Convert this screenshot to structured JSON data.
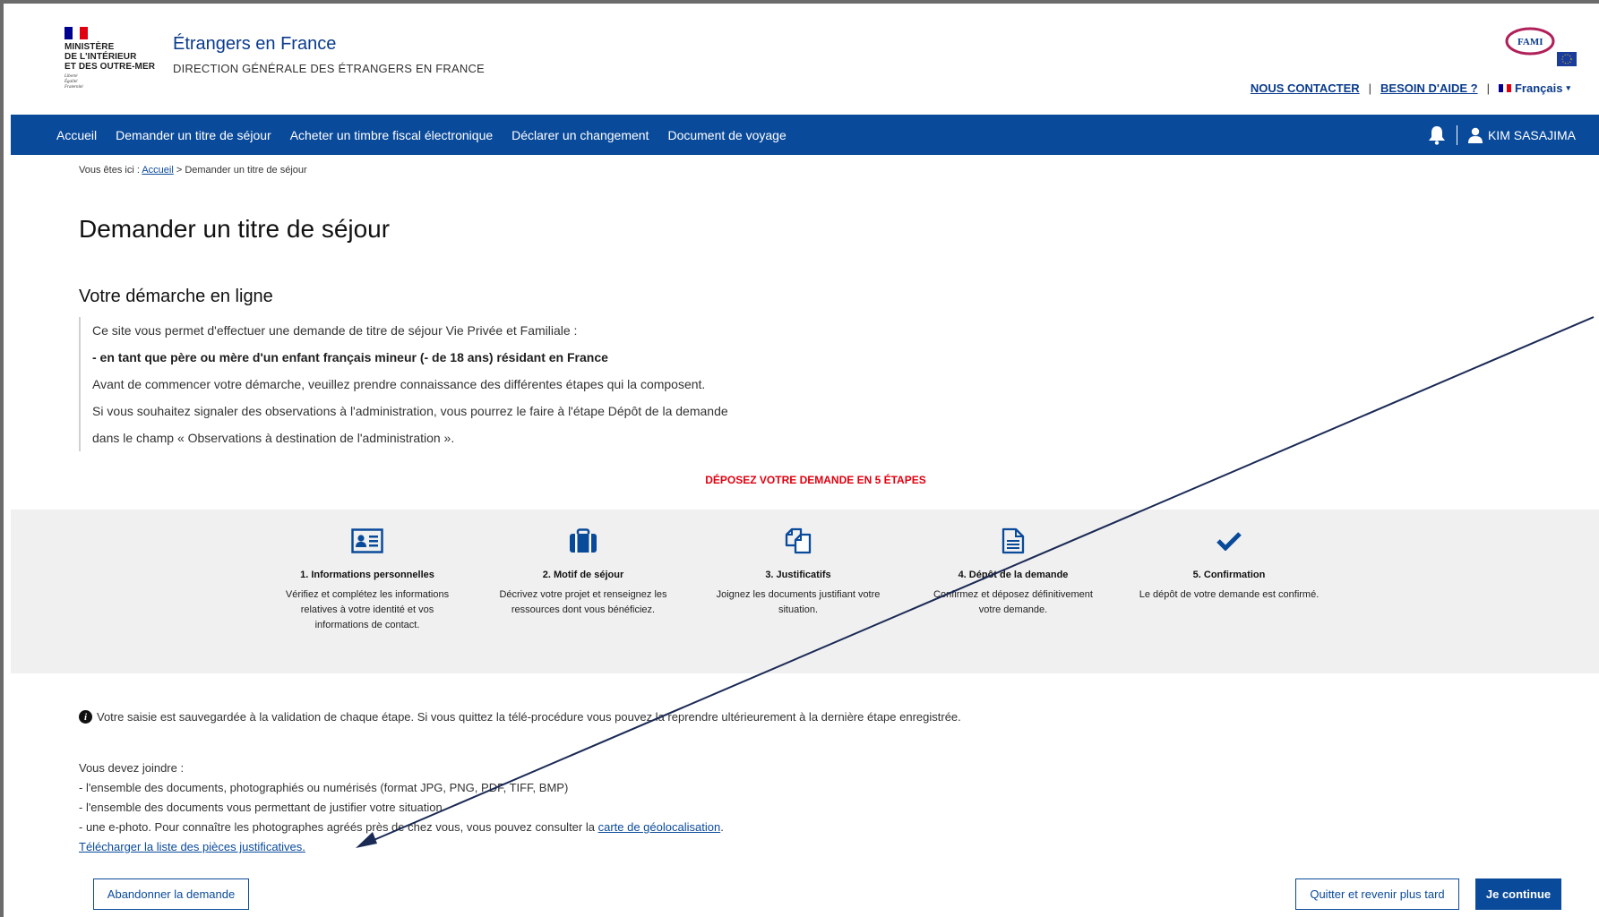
{
  "header": {
    "ministry_lines": [
      "MINISTÈRE",
      "DE L'INTÉRIEUR",
      "ET DES OUTRE-MER"
    ],
    "motto_lines": [
      "Liberté",
      "Égalité",
      "Fraternité"
    ],
    "site_title": "Étrangers en France",
    "site_subtitle": "DIRECTION GÉNÉRALE DES ÉTRANGERS EN FRANCE",
    "fami_label": "FAMI",
    "contact_link": "NOUS CONTACTER",
    "help_link": "BESOIN D'AIDE ?",
    "language": "Français"
  },
  "nav": {
    "items": [
      "Accueil",
      "Demander un titre de séjour",
      "Acheter un timbre fiscal électronique",
      "Déclarer un changement",
      "Document de voyage"
    ],
    "user_name": "KIM SASAJIMA"
  },
  "breadcrumb": {
    "prefix": "Vous êtes ici : ",
    "home": "Accueil",
    "current": " > Demander un titre de séjour"
  },
  "page_title": "Demander un titre de séjour",
  "section_title": "Votre démarche en ligne",
  "intro": [
    "Ce site vous permet d'effectuer une demande de titre de séjour Vie Privée et Familiale :",
    "- en tant que père ou mère d'un enfant français mineur (- de 18 ans) résidant en France",
    "Avant de commencer votre démarche, veuillez prendre connaissance des différentes étapes qui la composent.",
    "Si vous souhaitez signaler des observations à l'administration, vous pourrez le faire à l'étape Dépôt de la demande",
    "dans le champ « Observations à destination de l'administration »."
  ],
  "steps_heading": "DÉPOSEZ VOTRE DEMANDE EN 5 ÉTAPES",
  "steps": [
    {
      "icon": "id-card-icon",
      "title": "1. Informations personnelles",
      "desc": "Vérifiez et complétez les informations relatives à votre identité et vos informations de contact."
    },
    {
      "icon": "briefcase-icon",
      "title": "2. Motif de séjour",
      "desc": "Décrivez votre projet et renseignez les ressources dont vous bénéficiez."
    },
    {
      "icon": "copy-documents-icon",
      "title": "3. Justificatifs",
      "desc": "Joignez les documents justifiant votre situation."
    },
    {
      "icon": "document-icon",
      "title": "4. Dépôt de la demande",
      "desc": "Confirmez et déposez définitivement votre demande."
    },
    {
      "icon": "checkmark-icon",
      "title": "5. Confirmation",
      "desc": "Le dépôt de votre demande est confirmé."
    }
  ],
  "info_message": "Votre saisie est sauvegardée à la validation de chaque étape. Si vous quittez la télé-procédure vous pouvez la reprendre ultérieurement à la dernière étape enregistrée.",
  "docs": {
    "heading": "Vous devez joindre :",
    "line1": "- l'ensemble des documents, photographiés ou numérisés (format JPG, PNG, PDF, TIFF, BMP)",
    "line2": "- l'ensemble des documents vous permettant de justifier votre situation",
    "line3_prefix": "- une e-photo. Pour connaître les photographes agréés près de chez vous, vous pouvez consulter la ",
    "line3_link": "carte de géolocalisation",
    "line3_suffix": ".",
    "download_link": "Télécharger la liste des pièces justificatives."
  },
  "buttons": {
    "abandon": "Abandonner la demande",
    "quit": "Quitter et revenir plus tard",
    "continue": "Je continue"
  },
  "colors": {
    "primary": "#0a4a9a",
    "accent_red": "#e1000f",
    "band_gray": "#f0f0f0"
  }
}
